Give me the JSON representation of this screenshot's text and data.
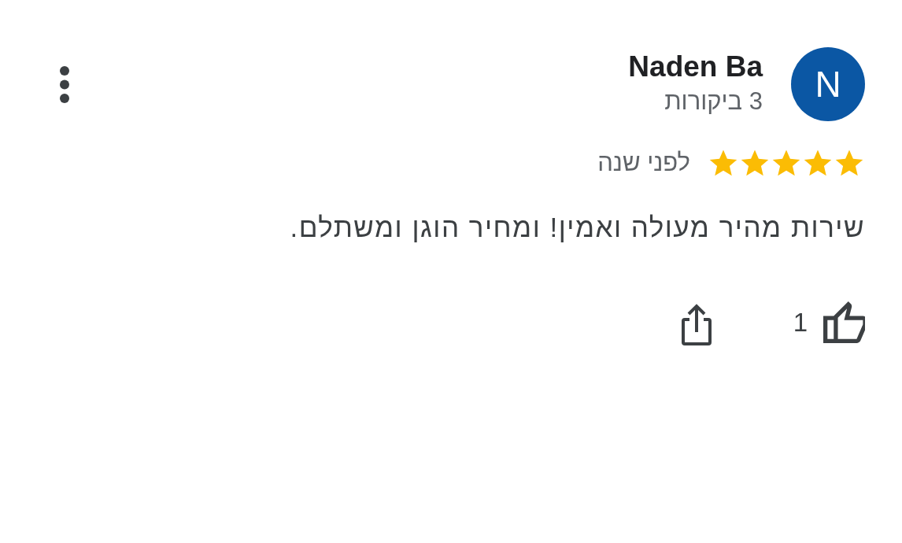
{
  "review": {
    "author": {
      "initial": "N",
      "name": "Naden Ba",
      "review_count": "3 ביקורות"
    },
    "stars": 5,
    "time": "לפני שנה",
    "text": "שירות מהיר מעולה ואמין! ומחיר הוגן ומשתלם.",
    "likes": "1"
  }
}
